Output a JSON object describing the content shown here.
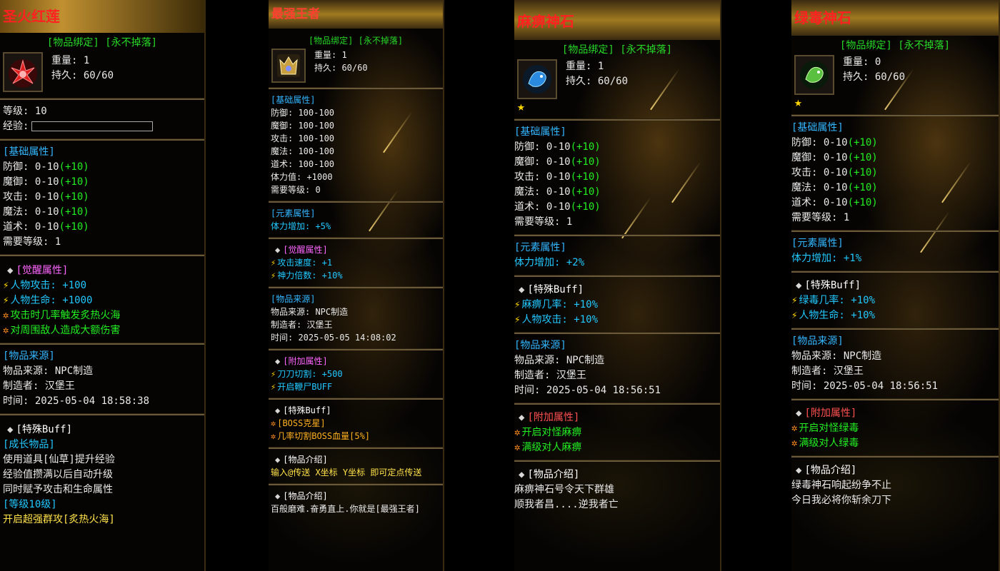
{
  "p1": {
    "title": "圣火红莲",
    "bind": "[物品绑定] [永不掉落]",
    "weight": "重量: 1",
    "durability": "持久: 60/60",
    "level": "等级: 10",
    "exp": "经验:",
    "base_head": "[基础属性]",
    "base": [
      {
        "k": "防御: 0-10",
        "v": "(+10)"
      },
      {
        "k": "魔御: 0-10",
        "v": "(+10)"
      },
      {
        "k": "攻击: 0-10",
        "v": "(+10)"
      },
      {
        "k": "魔法: 0-10",
        "v": "(+10)"
      },
      {
        "k": "道术: 0-10",
        "v": "(+10)"
      }
    ],
    "req": "需要等级: 1",
    "awake_head": "[觉醒属性]",
    "awake": [
      "人物攻击: +100",
      "人物生命: +1000"
    ],
    "awake_fx": [
      "攻击时几率触发炙热火海",
      "对周围敌人造成大额伤害"
    ],
    "src_head": "[物品来源]",
    "src": [
      "物品来源: NPC制造",
      "制造者: 汉堡王",
      "时间: 2025-05-04 18:58:38"
    ],
    "special_head": "[特殊Buff]",
    "grow_head": "[成长物品]",
    "grow": [
      "使用道具[仙草]提升经验",
      "经验值攒满以后自动升级",
      "同时赋予攻击和生命属性"
    ],
    "lv_head": "[等级10级]",
    "lv_fx": "开启超强群攻[炙热火海]"
  },
  "p2": {
    "title": "最强王者",
    "bind": "[物品绑定] [永不掉落]",
    "weight": "重量: 1",
    "durability": "持久: 60/60",
    "base_head": "[基础属性]",
    "base": [
      "防御: 100-100",
      "魔御: 100-100",
      "攻击: 100-100",
      "魔法: 100-100",
      "道术: 100-100",
      "体力值: +1000",
      "需要等级: 0"
    ],
    "elem_head": "[元素属性]",
    "elem": "体力增加: +5%",
    "awake_head": "[觉醒属性]",
    "awake": [
      "攻击速度: +1",
      "神力倍数: +10%"
    ],
    "src_head": "[物品来源]",
    "src": [
      "物品来源: NPC制造",
      "制造者: 汉堡王",
      "时间: 2025-05-05 14:08:02"
    ],
    "extra_head": "[附加属性]",
    "extra": [
      "刀刀切割: +500",
      "开启鞭尸BUFF"
    ],
    "special_head": "[特殊Buff]",
    "special": [
      "[BOSS克星]",
      "几率切割BOSS血量[5%]"
    ],
    "intro1_head": "[物品介绍]",
    "intro1": "输入@传送 X坐标 Y坐标 即可定点传送",
    "intro2_head": "[物品介绍]",
    "intro2": "百般磨难.奋勇直上.你就是[最强王者]"
  },
  "p3": {
    "title": "麻痹神石",
    "bind": "[物品绑定] [永不掉落]",
    "weight": "重量: 1",
    "durability": "持久: 60/60",
    "base_head": "[基础属性]",
    "base": [
      {
        "k": "防御: 0-10",
        "v": "(+10)"
      },
      {
        "k": "魔御: 0-10",
        "v": "(+10)"
      },
      {
        "k": "攻击: 0-10",
        "v": "(+10)"
      },
      {
        "k": "魔法: 0-10",
        "v": "(+10)"
      },
      {
        "k": "道术: 0-10",
        "v": "(+10)"
      }
    ],
    "req": "需要等级: 1",
    "elem_head": "[元素属性]",
    "elem": "体力增加: +2%",
    "special_head": "[特殊Buff]",
    "special": [
      "麻痹几率: +10%",
      "人物攻击: +10%"
    ],
    "src_head": "[物品来源]",
    "src": [
      "物品来源: NPC制造",
      "制造者: 汉堡王",
      "时间: 2025-05-04 18:56:51"
    ],
    "extra_head": "[附加属性]",
    "extra": [
      "开启对怪麻痹",
      "满级对人麻痹"
    ],
    "intro_head": "[物品介绍]",
    "intro": [
      "麻痹神石号令天下群雄",
      "顺我者昌....逆我者亡"
    ]
  },
  "p4": {
    "title": "绿毒神石",
    "bind": "[物品绑定] [永不掉落]",
    "weight": "重量: 0",
    "durability": "持久: 60/60",
    "base_head": "[基础属性]",
    "base": [
      {
        "k": "防御: 0-10",
        "v": "(+10)"
      },
      {
        "k": "魔御: 0-10",
        "v": "(+10)"
      },
      {
        "k": "攻击: 0-10",
        "v": "(+10)"
      },
      {
        "k": "魔法: 0-10",
        "v": "(+10)"
      },
      {
        "k": "道术: 0-10",
        "v": "(+10)"
      }
    ],
    "req": "需要等级: 1",
    "elem_head": "[元素属性]",
    "elem": "体力增加: +1%",
    "special_head": "[特殊Buff]",
    "special": [
      "绿毒几率: +10%",
      "人物生命: +10%"
    ],
    "src_head": "[物品来源]",
    "src": [
      "物品来源: NPC制造",
      "制造者: 汉堡王",
      "时间: 2025-05-04 18:56:51"
    ],
    "extra_head": "[附加属性]",
    "extra": [
      "开启对怪绿毒",
      "满级对人绿毒"
    ],
    "intro_head": "[物品介绍]",
    "intro": [
      "绿毒神石响起纷争不止",
      "今日我必将你斩余刀下"
    ]
  }
}
